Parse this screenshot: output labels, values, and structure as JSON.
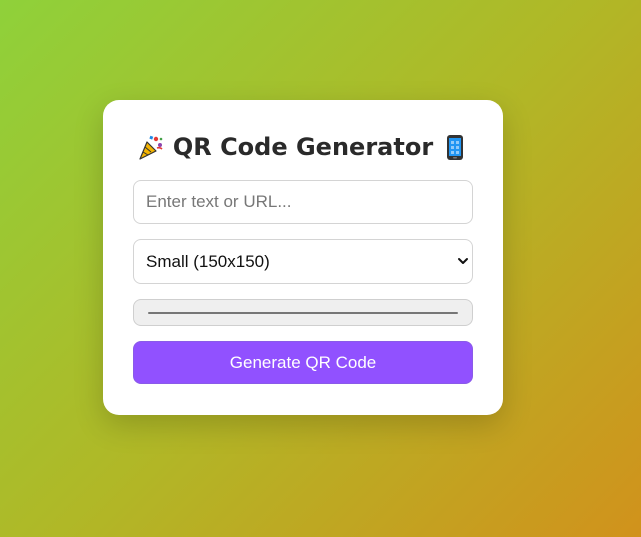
{
  "title": {
    "text": "QR Code Generator",
    "leading_icon": "party-popper-icon",
    "trailing_icon": "mobile-phone-icon"
  },
  "text_input": {
    "value": "",
    "placeholder": "Enter text or URL..."
  },
  "size_select": {
    "selected": "Small (150x150)"
  },
  "color_input": {
    "value": "#000000"
  },
  "generate_button": {
    "label": "Generate QR Code"
  },
  "colors": {
    "accent": "#9151ff",
    "card_background": "#ffffff",
    "gradient_start": "#8fd13a",
    "gradient_end": "#d1921c"
  }
}
